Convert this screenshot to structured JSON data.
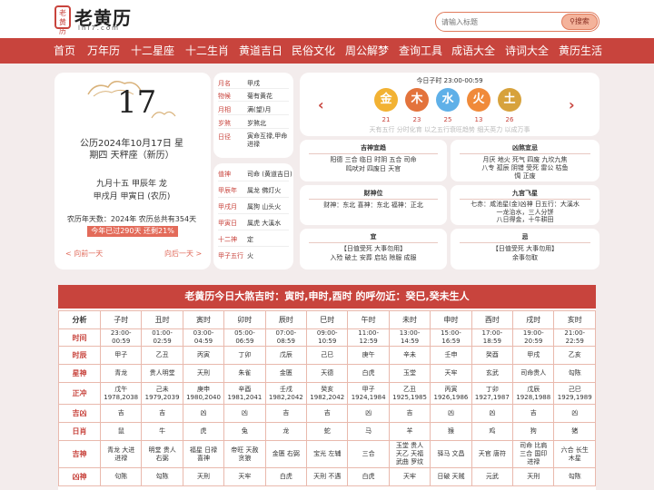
{
  "header": {
    "seal_text": "老黄历",
    "title": "老黄历",
    "domain": "lhl7.com",
    "search_placeholder": "请输入标题",
    "search_button": "搜索"
  },
  "nav": [
    "首页",
    "万年历",
    "十二星座",
    "十二生肖",
    "黄道吉日",
    "民俗文化",
    "周公解梦",
    "查询工具",
    "成语大全",
    "诗词大全",
    "黄历生活"
  ],
  "left_card": {
    "day": "17",
    "gregorian_line1": "公历2024年10月17日 星",
    "gregorian_line2": "期四 天秤座（新历）",
    "lunar_line1": "九月十五 甲辰年 龙",
    "lunar_line2": "甲戌月 甲寅日 (农历)",
    "year_days": "农历年天数：2024年 农历总共有354天",
    "progress_text": "今年已过290天 还剩21%",
    "progress_remaining_percent": 21,
    "prev": "< 向前一天",
    "next": "向后一天 >"
  },
  "info_top": [
    {
      "label": "月名",
      "value": "甲戌"
    },
    {
      "label": "物候",
      "value": "菊有黄花"
    },
    {
      "label": "月相",
      "value": "满(望)月"
    },
    {
      "label": "岁煞",
      "value": "岁煞北"
    },
    {
      "label": "日径",
      "value": "寅命互禄,甲命进禄"
    }
  ],
  "info_bottom": [
    {
      "label": "值神",
      "value": "司命 (黄道吉日)"
    },
    {
      "label": "甲辰年",
      "value": "属龙 佛灯火"
    },
    {
      "label": "甲戌月",
      "value": "属狗 山头火"
    },
    {
      "label": "甲寅日",
      "value": "属虎 大溪水"
    },
    {
      "label": "十二神",
      "value": "定"
    },
    {
      "label": "甲子五行",
      "value": "火"
    }
  ],
  "wuxing": {
    "title": "今日子时 23:00-00:59",
    "elements": [
      {
        "char": "金",
        "num": "21",
        "color": "#f2b233"
      },
      {
        "char": "木",
        "num": "23",
        "color": "#e3733c"
      },
      {
        "char": "水",
        "num": "25",
        "color": "#5fb0e8"
      },
      {
        "char": "火",
        "num": "13",
        "color": "#f08a3a"
      },
      {
        "char": "土",
        "num": "26",
        "color": "#d7a23c"
      }
    ],
    "note": "天有五行 分时化育 以之五行衰旺趋势 细天英力 以成万事"
  },
  "yiji": {
    "good_title": "吉神宜趋",
    "good_text": [
      "阳德 三合 临日 时阴 五合 司命",
      "鸣吠对  四废日  天官"
    ],
    "bad_title": "凶煞宜忌",
    "bad_text": [
      "月厌 地火 死气 四废 九坎九焦",
      "八专 孤辰 阴错 受死 雷公 枯鱼",
      "惆 正废"
    ],
    "wealth_title": "财神位",
    "wealth_text": "财神：东北  喜神：东北  福神：正北",
    "star_title": "九宫飞星",
    "star_text": [
      "七赤：咸池星(金)凶神 日五行：大溪水",
      "一龙治水，三人分饼",
      "八日得金，十牛耕田"
    ],
    "yi_title": "宜",
    "yi_text": [
      "【日值受死 大事勿用】",
      "入殓 破土 安葬 启钻 除服 成服"
    ],
    "ji_title": "忌",
    "ji_text": [
      "【日值受死 大事勿用】",
      "余事勿取"
    ]
  },
  "table": {
    "title": "老黄历今日大煞吉时：寅时,申时,酉时 的呼勿近：癸巳,癸未生人",
    "rows": [
      {
        "label": "分析",
        "cells": [
          "子时",
          "丑时",
          "寅时",
          "卯时",
          "辰时",
          "巳时",
          "午时",
          "未时",
          "申时",
          "酉时",
          "戌时",
          "亥时"
        ]
      },
      {
        "label": "时间",
        "cells": [
          "23:00-00:59",
          "01:00-02:59",
          "03:00-04:59",
          "05:00-06:59",
          "07:00-08:59",
          "09:00-10:59",
          "11:00-12:59",
          "13:00-14:59",
          "15:00-16:59",
          "17:00-18:59",
          "19:00-20:59",
          "21:00-22:59"
        ]
      },
      {
        "label": "时辰",
        "cells": [
          "甲子",
          "乙丑",
          "丙寅",
          "丁卯",
          "戊辰",
          "己巳",
          "庚午",
          "辛未",
          "壬申",
          "癸酉",
          "甲戌",
          "乙亥"
        ]
      },
      {
        "label": "星神",
        "cells": [
          "青龙",
          "贵人明堂",
          "天刑",
          "朱雀",
          "金匮",
          "天德",
          "白虎",
          "玉堂",
          "天牢",
          "玄武",
          "司命贵人",
          "勾陈"
        ]
      },
      {
        "label": "正冲",
        "cells": [
          "戊午\n1978,2038",
          "己未\n1979,2039",
          "庚申\n1980,2040",
          "辛酉\n1981,2041",
          "壬戌\n1982,2042",
          "癸亥\n1982,2042",
          "甲子\n1924,1984",
          "乙丑\n1925,1985",
          "丙寅\n1926,1986",
          "丁卯\n1927,1987",
          "戊辰\n1928,1988",
          "己巳\n1929,1989"
        ]
      },
      {
        "label": "吉凶",
        "cells": [
          "吉",
          "吉",
          "凶",
          "凶",
          "吉",
          "吉",
          "凶",
          "吉",
          "凶",
          "凶",
          "吉",
          "凶"
        ]
      },
      {
        "label": "日肖",
        "cells": [
          "鼠",
          "牛",
          "虎",
          "兔",
          "龙",
          "蛇",
          "马",
          "羊",
          "猴",
          "鸡",
          "狗",
          "猪"
        ]
      },
      {
        "label": "吉神",
        "cells": [
          "青龙 大进\n进禄",
          "明堂 贵人\n右弼",
          "福星 日禄\n喜神",
          "帝旺 天赦\n贪狼",
          "金匮 右弼",
          "宝光 左辅",
          "三合",
          "玉堂 贵人\n天乙 天福\n武曲 罗纹",
          "驿马 文昌",
          "天官 唐符",
          "司命 比肩\n三合 国印\n进禄",
          "六合 长生\n木星"
        ]
      },
      {
        "label": "凶神",
        "cells": [
          "句陈",
          "勾陈",
          "天刑",
          "天牢",
          "白虎",
          "天刑 不遇",
          "白虎",
          "天牢",
          "日破 天贼",
          "元武",
          "天刑",
          "勾陈"
        ]
      }
    ]
  }
}
